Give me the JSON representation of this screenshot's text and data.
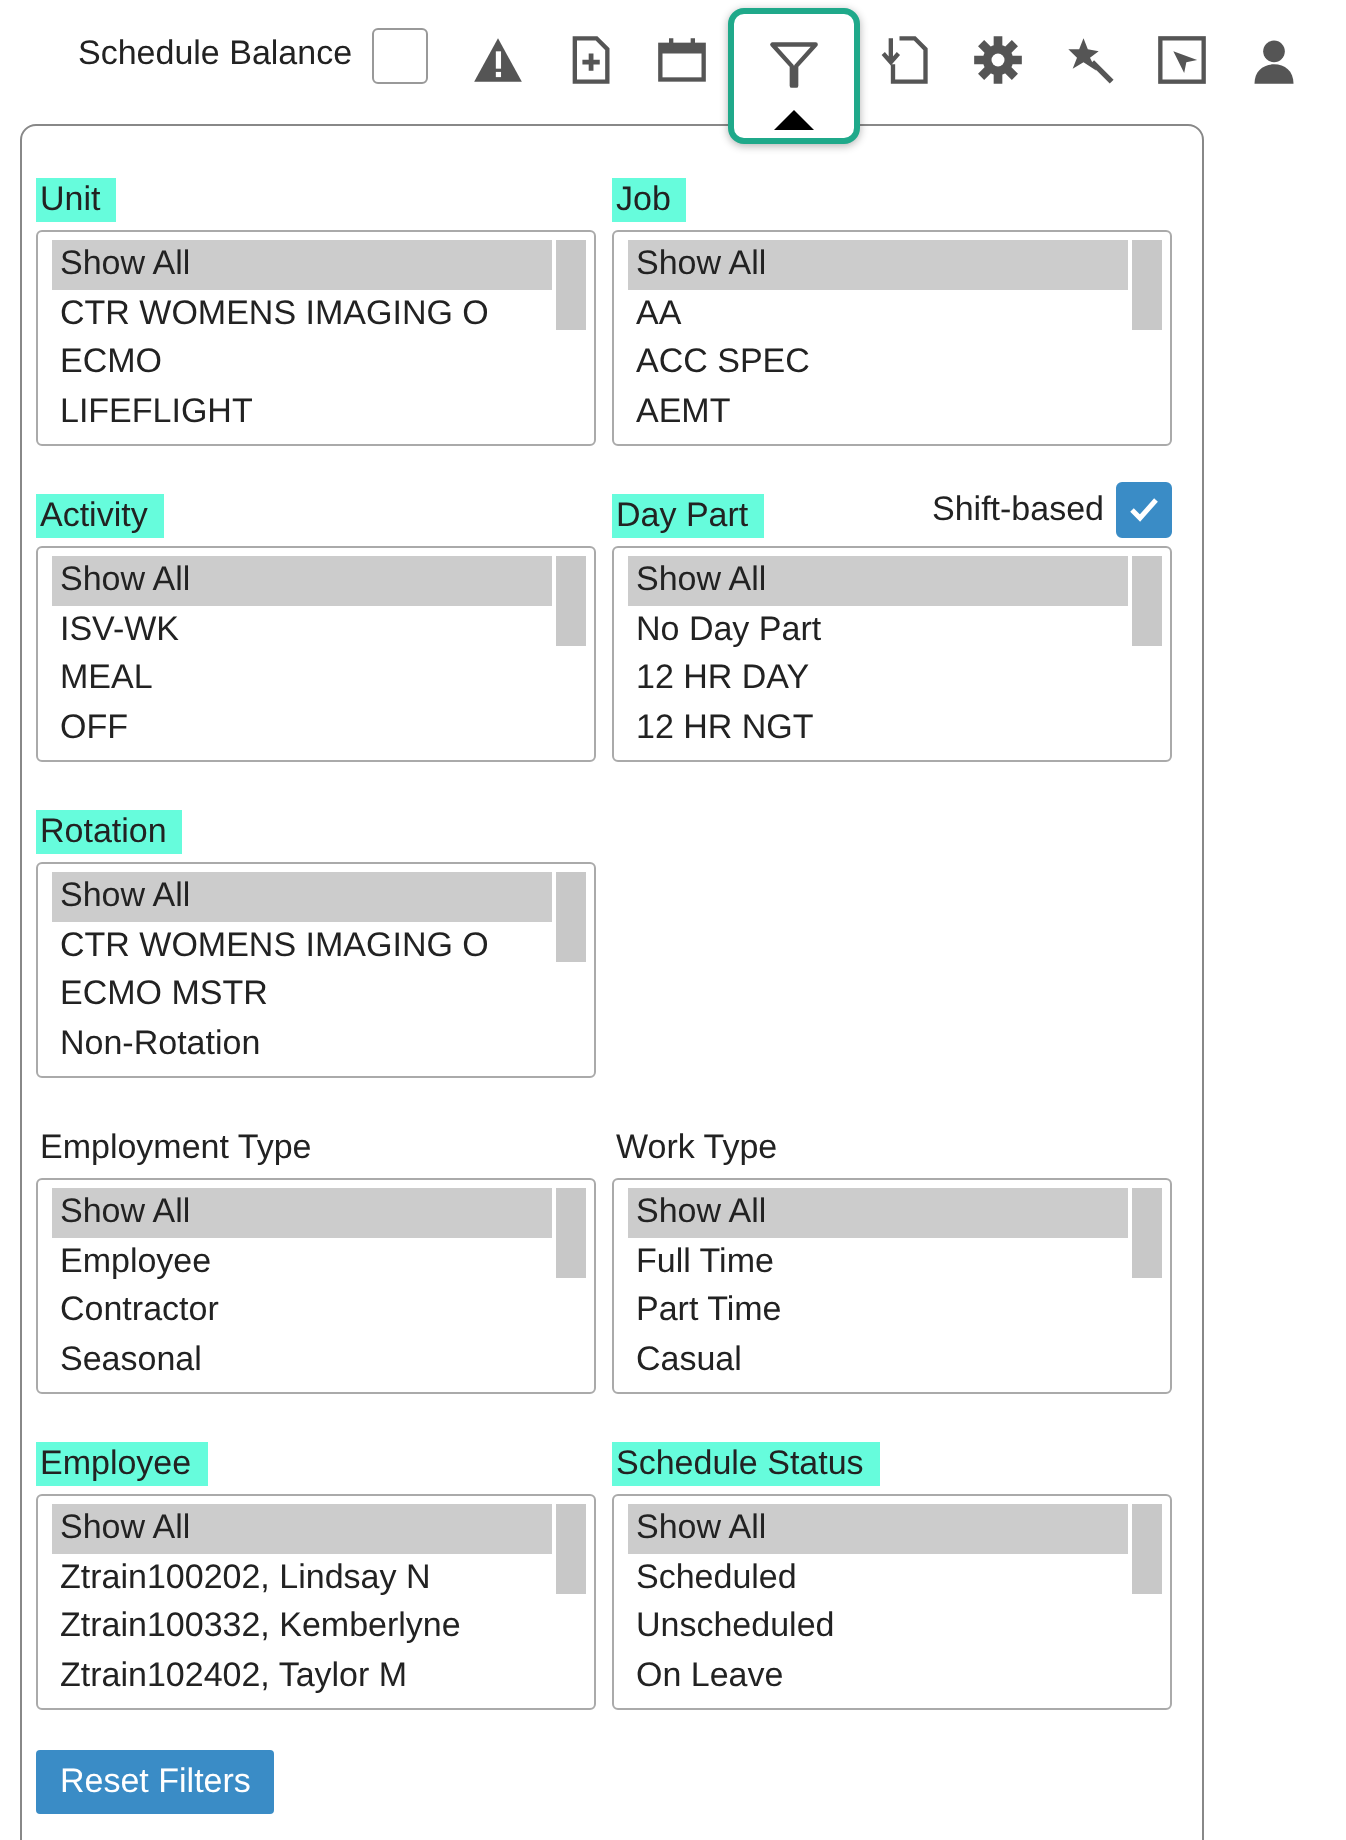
{
  "toolbar": {
    "schedule_balance": {
      "label": "Schedule Balance",
      "checked": false
    },
    "tools": [
      {
        "kind": "warning",
        "selected": false
      },
      {
        "kind": "file-plus",
        "selected": false
      },
      {
        "kind": "calendar",
        "selected": false
      },
      {
        "kind": "filter",
        "selected": true
      },
      {
        "kind": "download",
        "selected": false
      },
      {
        "kind": "gear",
        "selected": false
      },
      {
        "kind": "wand",
        "selected": false
      },
      {
        "kind": "cursor",
        "selected": false
      },
      {
        "kind": "person",
        "selected": false
      }
    ]
  },
  "filter_rows": [
    [
      {
        "label": "Unit",
        "highlighted": true,
        "options": [
          {
            "text": "Show All",
            "selected": true
          },
          {
            "text": "CTR WOMENS IMAGING O",
            "selected": false
          },
          {
            "text": "ECMO",
            "selected": false
          },
          {
            "text": "LIFEFLIGHT",
            "selected": false
          }
        ]
      },
      {
        "label": "Job",
        "highlighted": true,
        "options": [
          {
            "text": "Show All",
            "selected": true
          },
          {
            "text": "AA",
            "selected": false
          },
          {
            "text": "ACC SPEC",
            "selected": false
          },
          {
            "text": "AEMT",
            "selected": false
          }
        ]
      }
    ],
    [
      {
        "label": "Activity",
        "highlighted": true,
        "options": [
          {
            "text": "Show All",
            "selected": true
          },
          {
            "text": "ISV-WK",
            "selected": false
          },
          {
            "text": "MEAL",
            "selected": false
          },
          {
            "text": "OFF",
            "selected": false
          }
        ]
      },
      {
        "label": "Day Part",
        "highlighted": true,
        "shift_based": {
          "label": "Shift-based",
          "checked": true
        },
        "options": [
          {
            "text": "Show All",
            "selected": true
          },
          {
            "text": "No Day Part",
            "selected": false
          },
          {
            "text": "12 HR DAY",
            "selected": false
          },
          {
            "text": "12 HR NGT",
            "selected": false
          }
        ]
      }
    ],
    [
      {
        "label": "Rotation",
        "highlighted": true,
        "options": [
          {
            "text": "Show All",
            "selected": true
          },
          {
            "text": "CTR WOMENS IMAGING O",
            "selected": false
          },
          {
            "text": "ECMO MSTR",
            "selected": false
          },
          {
            "text": "Non-Rotation",
            "selected": false
          }
        ]
      }
    ],
    [
      {
        "label": "Employment Type",
        "highlighted": false,
        "options": [
          {
            "text": "Show All",
            "selected": true
          },
          {
            "text": "Employee",
            "selected": false
          },
          {
            "text": "Contractor",
            "selected": false
          },
          {
            "text": "Seasonal",
            "selected": false
          }
        ]
      },
      {
        "label": "Work Type",
        "highlighted": false,
        "options": [
          {
            "text": "Show All",
            "selected": true
          },
          {
            "text": "Full Time",
            "selected": false
          },
          {
            "text": "Part Time",
            "selected": false
          },
          {
            "text": "Casual",
            "selected": false
          }
        ]
      }
    ],
    [
      {
        "label": "Employee",
        "highlighted": true,
        "options": [
          {
            "text": "Show All",
            "selected": true
          },
          {
            "text": "Ztrain100202, Lindsay N",
            "selected": false
          },
          {
            "text": "Ztrain100332, Kemberlyne",
            "selected": false
          },
          {
            "text": "Ztrain102402, Taylor M",
            "selected": false
          }
        ]
      },
      {
        "label": "Schedule Status",
        "highlighted": true,
        "options": [
          {
            "text": "Show All",
            "selected": true
          },
          {
            "text": "Scheduled",
            "selected": false
          },
          {
            "text": "Unscheduled",
            "selected": false
          },
          {
            "text": "On Leave",
            "selected": false
          }
        ]
      }
    ]
  ],
  "reset_button": "Reset Filters"
}
